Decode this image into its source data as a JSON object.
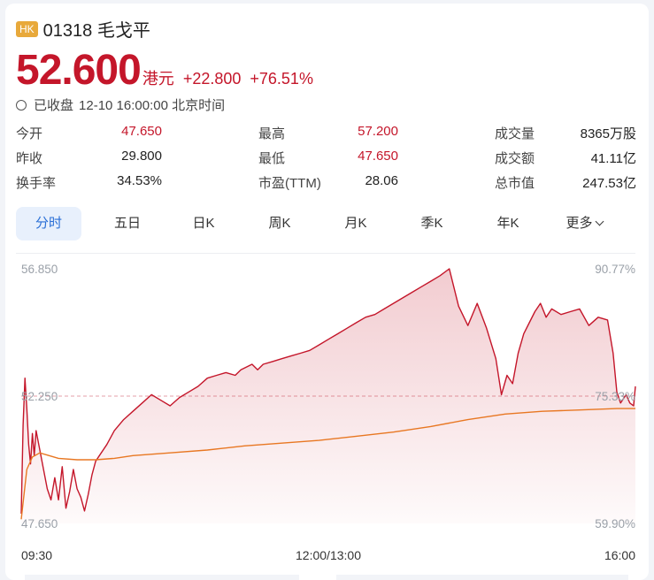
{
  "header": {
    "badge": "HK",
    "title": "01318 毛戈平",
    "price": "52.600",
    "price_unit": "港元",
    "change": "+22.800",
    "change_pct": "+76.51%",
    "status": "已收盘",
    "datetime": "12-10 16:00:00 北京时间"
  },
  "stats": [
    {
      "label": "今开",
      "value": "47.650",
      "red": true
    },
    {
      "label": "最高",
      "value": "57.200",
      "red": true
    },
    {
      "label": "成交量",
      "value": "8365万股",
      "red": false
    },
    {
      "label": "昨收",
      "value": "29.800",
      "red": false
    },
    {
      "label": "最低",
      "value": "47.650",
      "red": true
    },
    {
      "label": "成交额",
      "value": "41.11亿",
      "red": false
    },
    {
      "label": "换手率",
      "value": "34.53%",
      "red": false
    },
    {
      "label": "市盈(TTM)",
      "value": "28.06",
      "red": false
    },
    {
      "label": "总市值",
      "value": "247.53亿",
      "red": false
    }
  ],
  "tabs": [
    "分时",
    "五日",
    "日K",
    "周K",
    "月K",
    "季K",
    "年K",
    "更多"
  ],
  "active_tab": "分时",
  "colors": {
    "up": "#c4162a",
    "avg_line": "#e87722",
    "active_tab": "#2a6fd6",
    "badge": "#e8a93b"
  },
  "chart_data": {
    "type": "line",
    "y_left_ticks": [
      "56.850",
      "52.250",
      "47.650"
    ],
    "y_right_ticks": [
      "90.77%",
      "75.33%",
      "59.90%"
    ],
    "x_ticks": [
      "09:30",
      "12:00/13:00",
      "16:00"
    ],
    "ylim": [
      47.65,
      56.85
    ],
    "reference_close": 52.25,
    "x_range_minutes": [
      0,
      330
    ],
    "series": [
      {
        "key": "price",
        "x": [
          0,
          1,
          2,
          3,
          4,
          5,
          6,
          7,
          8,
          10,
          12,
          14,
          16,
          18,
          20,
          22,
          24,
          26,
          28,
          30,
          32,
          34,
          36,
          38,
          40,
          43,
          46,
          50,
          55,
          60,
          65,
          70,
          75,
          80,
          85,
          90,
          95,
          100,
          105,
          110,
          115,
          118,
          121,
          124,
          127,
          130,
          135,
          140,
          145,
          150,
          155,
          160,
          165,
          170,
          175,
          180,
          185,
          190,
          195,
          200,
          205,
          210,
          215,
          220,
          225,
          230,
          235,
          240,
          245,
          250,
          255,
          258,
          261,
          264,
          267,
          270,
          273,
          276,
          279,
          282,
          285,
          290,
          295,
          300,
          305,
          310,
          315,
          318,
          320,
          322,
          325,
          327,
          329,
          330
        ],
        "values": [
          48.0,
          51.2,
          52.9,
          51.8,
          50.5,
          49.8,
          50.9,
          50.1,
          51.0,
          50.3,
          49.6,
          48.9,
          48.5,
          49.3,
          48.5,
          49.7,
          48.2,
          48.8,
          49.6,
          48.9,
          48.6,
          48.1,
          48.7,
          49.4,
          49.9,
          50.2,
          50.5,
          51.0,
          51.4,
          51.7,
          52.0,
          52.3,
          52.1,
          51.9,
          52.2,
          52.4,
          52.6,
          52.9,
          53.0,
          53.1,
          53.0,
          53.2,
          53.3,
          53.4,
          53.2,
          53.4,
          53.5,
          53.6,
          53.7,
          53.8,
          53.9,
          54.1,
          54.3,
          54.5,
          54.7,
          54.9,
          55.1,
          55.2,
          55.4,
          55.6,
          55.8,
          56.0,
          56.2,
          56.4,
          56.6,
          56.85,
          55.5,
          54.8,
          55.6,
          54.7,
          53.6,
          52.3,
          53.0,
          52.7,
          53.8,
          54.5,
          54.9,
          55.3,
          55.6,
          55.1,
          55.4,
          55.2,
          55.3,
          55.4,
          54.8,
          55.1,
          55.0,
          53.8,
          52.4,
          52.0,
          52.3,
          52.0,
          51.9,
          52.6
        ]
      },
      {
        "key": "avg",
        "x": [
          0,
          3,
          6,
          10,
          15,
          20,
          30,
          40,
          50,
          60,
          80,
          100,
          120,
          140,
          160,
          180,
          200,
          220,
          240,
          260,
          280,
          300,
          320,
          330
        ],
        "values": [
          47.8,
          49.6,
          50.05,
          50.2,
          50.1,
          50.0,
          49.95,
          49.95,
          50.0,
          50.1,
          50.2,
          50.3,
          50.45,
          50.55,
          50.65,
          50.8,
          50.95,
          51.15,
          51.4,
          51.6,
          51.7,
          51.75,
          51.8,
          51.8
        ]
      }
    ]
  }
}
